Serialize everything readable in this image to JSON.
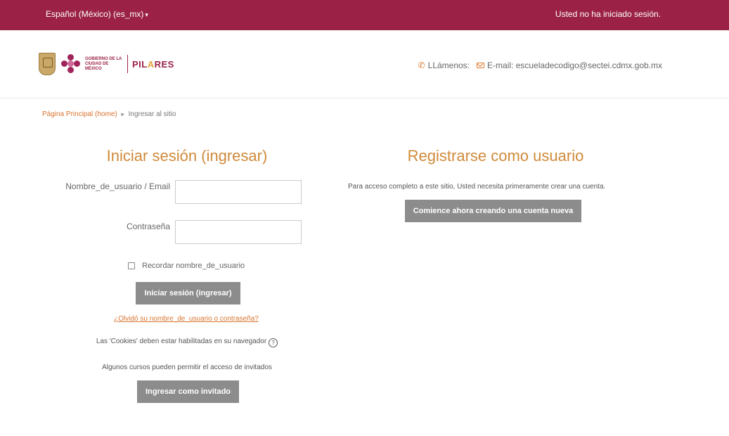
{
  "topbar": {
    "language": "Español (México) (es_mx)",
    "caret": "▾",
    "login_status": "Usted no ha iniciado sesión."
  },
  "header": {
    "logo_gob_text_1": "GOBIERNO DE LA",
    "logo_gob_text_2": "CIUDAD DE MÉXICO",
    "logo_pilares_1": "PIL",
    "logo_pilares_2": "A",
    "logo_pilares_3": "RES",
    "phone_label": "LLámenos:",
    "email_label": "E-mail:",
    "email_value": "escueladecodigo@sectei.cdmx.gob.mx"
  },
  "breadcrumb": {
    "home": "Página Principal (home)",
    "separator": "►",
    "current": "Ingresar al sitio"
  },
  "login": {
    "title": "Iniciar sesión (ingresar)",
    "username_label": "Nombre_de_usuario / Email",
    "username_value": "",
    "password_label": "Contraseña",
    "password_value": "",
    "remember_label": "Recordar nombre_de_usuario",
    "submit_label": "Iniciar sesión (ingresar)",
    "forgot_link": "¿Olvidó su nombre_de_usuario o contraseña?",
    "cookies_text": "Las 'Cookies' deben estar habilitadas en su navegador",
    "help_glyph": "?",
    "guests_text": "Algunos cursos pueden permitir el acceso de invitados",
    "guest_button": "Ingresar como invitado"
  },
  "register": {
    "title": "Registrarse como usuario",
    "text": "Para acceso completo a este sitio, Usted necesita primeramente crear una cuenta.",
    "button": "Comience ahora creando una cuenta nueva"
  },
  "colors": {
    "brand": "#9b2246",
    "accent": "#d08a3a",
    "link": "#d8742e",
    "button": "#8c8c8c"
  }
}
